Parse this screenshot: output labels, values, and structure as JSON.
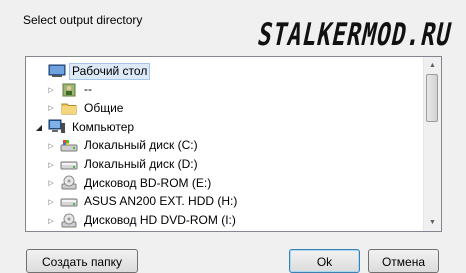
{
  "dialog": {
    "prompt": "Select output directory",
    "watermark": "STALKERMOD.RU"
  },
  "tree": {
    "items": [
      {
        "label": "Рабочий стол",
        "icon": "desktop-icon",
        "expander": "none",
        "selected": true
      },
      {
        "label": "--",
        "icon": "user-folder-icon",
        "expander": "collapsed"
      },
      {
        "label": "Общие",
        "icon": "folder-icon",
        "expander": "collapsed"
      },
      {
        "label": "Компьютер",
        "icon": "computer-icon",
        "expander": "expanded"
      },
      {
        "label": "Локальный диск (C:)",
        "icon": "system-drive-icon",
        "expander": "collapsed"
      },
      {
        "label": "Локальный диск (D:)",
        "icon": "hard-drive-icon",
        "expander": "collapsed"
      },
      {
        "label": "Дисковод BD-ROM (E:)",
        "icon": "optical-drive-icon",
        "expander": "collapsed"
      },
      {
        "label": "ASUS AN200 EXT. HDD (H:)",
        "icon": "hard-drive-icon",
        "expander": "collapsed"
      },
      {
        "label": "Дисковод HD DVD-ROM (I:)",
        "icon": "optical-drive-icon",
        "expander": "collapsed"
      }
    ]
  },
  "buttons": {
    "make_folder": "Создать папку",
    "ok": "Ok",
    "cancel": "Отмена"
  }
}
